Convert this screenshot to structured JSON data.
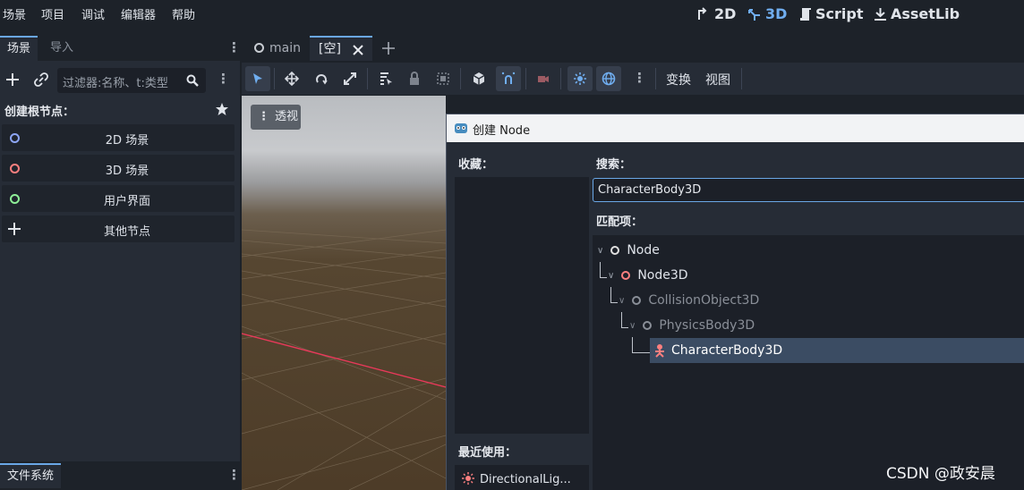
{
  "menubar": {
    "items": [
      "场景",
      "项目",
      "调试",
      "编辑器",
      "帮助"
    ],
    "modes": [
      {
        "label": "2D",
        "icon": "2d-icon",
        "active": false
      },
      {
        "label": "3D",
        "icon": "3d-icon",
        "active": true
      },
      {
        "label": "Script",
        "icon": "script-icon",
        "active": false
      },
      {
        "label": "AssetLib",
        "icon": "assetlib-icon",
        "active": false
      }
    ]
  },
  "scene_dock": {
    "tabs": [
      "场景",
      "导入"
    ],
    "filter_placeholder": "过滤器:名称、t:类型",
    "create_root_label": "创建根节点：",
    "root_buttons": [
      {
        "label": "2D 场景",
        "color": "#8da5f3"
      },
      {
        "label": "3D 场景",
        "color": "#fc7f7f"
      },
      {
        "label": "用户界面",
        "color": "#8eef97"
      },
      {
        "label": "其他节点",
        "color": "#e0e0e0"
      }
    ],
    "filesystem_tab": "文件系统"
  },
  "editor": {
    "tabs": [
      "main",
      "[空]"
    ],
    "toolbar_menus": [
      "变换",
      "视图"
    ],
    "viewport_button": "透视"
  },
  "dialog": {
    "title": "创建 Node",
    "favorites_label": "收藏：",
    "recent_label": "最近使用：",
    "recent_items": [
      "DirectionalLig..."
    ],
    "search_label": "搜索：",
    "search_value": "CharacterBody3D",
    "matches_label": "匹配项：",
    "tree": [
      {
        "label": "Node",
        "color": "#e0e0e0",
        "dim": false
      },
      {
        "label": "Node3D",
        "color": "#fc7f7f",
        "dim": false
      },
      {
        "label": "CollisionObject3D",
        "color": "#8a8f98",
        "dim": true
      },
      {
        "label": "PhysicsBody3D",
        "color": "#8a8f98",
        "dim": true
      },
      {
        "label": "CharacterBody3D",
        "color": "#fc7f7f",
        "dim": false,
        "selected": true
      }
    ]
  },
  "watermark": "CSDN @政安晨"
}
